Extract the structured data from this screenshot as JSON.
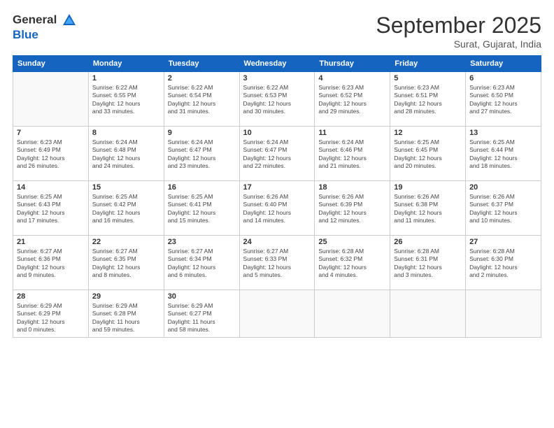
{
  "header": {
    "logo_line1": "General",
    "logo_line2": "Blue",
    "month": "September 2025",
    "location": "Surat, Gujarat, India"
  },
  "days_of_week": [
    "Sunday",
    "Monday",
    "Tuesday",
    "Wednesday",
    "Thursday",
    "Friday",
    "Saturday"
  ],
  "weeks": [
    [
      {
        "day": "",
        "info": ""
      },
      {
        "day": "1",
        "info": "Sunrise: 6:22 AM\nSunset: 6:55 PM\nDaylight: 12 hours\nand 33 minutes."
      },
      {
        "day": "2",
        "info": "Sunrise: 6:22 AM\nSunset: 6:54 PM\nDaylight: 12 hours\nand 31 minutes."
      },
      {
        "day": "3",
        "info": "Sunrise: 6:22 AM\nSunset: 6:53 PM\nDaylight: 12 hours\nand 30 minutes."
      },
      {
        "day": "4",
        "info": "Sunrise: 6:23 AM\nSunset: 6:52 PM\nDaylight: 12 hours\nand 29 minutes."
      },
      {
        "day": "5",
        "info": "Sunrise: 6:23 AM\nSunset: 6:51 PM\nDaylight: 12 hours\nand 28 minutes."
      },
      {
        "day": "6",
        "info": "Sunrise: 6:23 AM\nSunset: 6:50 PM\nDaylight: 12 hours\nand 27 minutes."
      }
    ],
    [
      {
        "day": "7",
        "info": "Sunrise: 6:23 AM\nSunset: 6:49 PM\nDaylight: 12 hours\nand 26 minutes."
      },
      {
        "day": "8",
        "info": "Sunrise: 6:24 AM\nSunset: 6:48 PM\nDaylight: 12 hours\nand 24 minutes."
      },
      {
        "day": "9",
        "info": "Sunrise: 6:24 AM\nSunset: 6:47 PM\nDaylight: 12 hours\nand 23 minutes."
      },
      {
        "day": "10",
        "info": "Sunrise: 6:24 AM\nSunset: 6:47 PM\nDaylight: 12 hours\nand 22 minutes."
      },
      {
        "day": "11",
        "info": "Sunrise: 6:24 AM\nSunset: 6:46 PM\nDaylight: 12 hours\nand 21 minutes."
      },
      {
        "day": "12",
        "info": "Sunrise: 6:25 AM\nSunset: 6:45 PM\nDaylight: 12 hours\nand 20 minutes."
      },
      {
        "day": "13",
        "info": "Sunrise: 6:25 AM\nSunset: 6:44 PM\nDaylight: 12 hours\nand 18 minutes."
      }
    ],
    [
      {
        "day": "14",
        "info": "Sunrise: 6:25 AM\nSunset: 6:43 PM\nDaylight: 12 hours\nand 17 minutes."
      },
      {
        "day": "15",
        "info": "Sunrise: 6:25 AM\nSunset: 6:42 PM\nDaylight: 12 hours\nand 16 minutes."
      },
      {
        "day": "16",
        "info": "Sunrise: 6:25 AM\nSunset: 6:41 PM\nDaylight: 12 hours\nand 15 minutes."
      },
      {
        "day": "17",
        "info": "Sunrise: 6:26 AM\nSunset: 6:40 PM\nDaylight: 12 hours\nand 14 minutes."
      },
      {
        "day": "18",
        "info": "Sunrise: 6:26 AM\nSunset: 6:39 PM\nDaylight: 12 hours\nand 12 minutes."
      },
      {
        "day": "19",
        "info": "Sunrise: 6:26 AM\nSunset: 6:38 PM\nDaylight: 12 hours\nand 11 minutes."
      },
      {
        "day": "20",
        "info": "Sunrise: 6:26 AM\nSunset: 6:37 PM\nDaylight: 12 hours\nand 10 minutes."
      }
    ],
    [
      {
        "day": "21",
        "info": "Sunrise: 6:27 AM\nSunset: 6:36 PM\nDaylight: 12 hours\nand 9 minutes."
      },
      {
        "day": "22",
        "info": "Sunrise: 6:27 AM\nSunset: 6:35 PM\nDaylight: 12 hours\nand 8 minutes."
      },
      {
        "day": "23",
        "info": "Sunrise: 6:27 AM\nSunset: 6:34 PM\nDaylight: 12 hours\nand 6 minutes."
      },
      {
        "day": "24",
        "info": "Sunrise: 6:27 AM\nSunset: 6:33 PM\nDaylight: 12 hours\nand 5 minutes."
      },
      {
        "day": "25",
        "info": "Sunrise: 6:28 AM\nSunset: 6:32 PM\nDaylight: 12 hours\nand 4 minutes."
      },
      {
        "day": "26",
        "info": "Sunrise: 6:28 AM\nSunset: 6:31 PM\nDaylight: 12 hours\nand 3 minutes."
      },
      {
        "day": "27",
        "info": "Sunrise: 6:28 AM\nSunset: 6:30 PM\nDaylight: 12 hours\nand 2 minutes."
      }
    ],
    [
      {
        "day": "28",
        "info": "Sunrise: 6:29 AM\nSunset: 6:29 PM\nDaylight: 12 hours\nand 0 minutes."
      },
      {
        "day": "29",
        "info": "Sunrise: 6:29 AM\nSunset: 6:28 PM\nDaylight: 11 hours\nand 59 minutes."
      },
      {
        "day": "30",
        "info": "Sunrise: 6:29 AM\nSunset: 6:27 PM\nDaylight: 11 hours\nand 58 minutes."
      },
      {
        "day": "",
        "info": ""
      },
      {
        "day": "",
        "info": ""
      },
      {
        "day": "",
        "info": ""
      },
      {
        "day": "",
        "info": ""
      }
    ]
  ]
}
